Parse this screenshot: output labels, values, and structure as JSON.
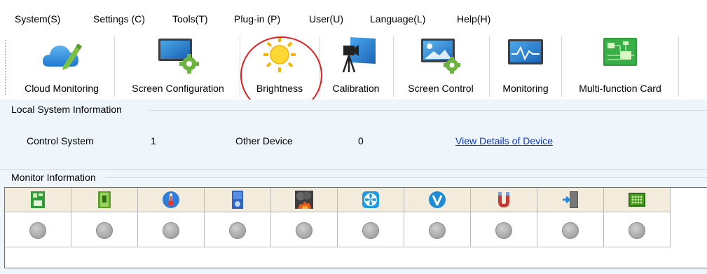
{
  "menu": {
    "items": [
      "System(S)",
      "Settings (C)",
      "Tools(T)",
      "Plug-in (P)",
      "User(U)",
      "Language(L)",
      "Help(H)"
    ]
  },
  "toolbar": {
    "tools": [
      {
        "label": "Cloud Monitoring",
        "icon": "cloud-edit-icon"
      },
      {
        "label": "Screen Configuration",
        "icon": "screen-gear-icon"
      },
      {
        "label": "Brightness",
        "icon": "sun-icon"
      },
      {
        "label": "Calibration",
        "icon": "camera-screen-icon"
      },
      {
        "label": "Screen Control",
        "icon": "screen-image-gear-icon"
      },
      {
        "label": "Monitoring",
        "icon": "monitor-wave-icon"
      },
      {
        "label": "Multi-function Card",
        "icon": "circuit-board-icon"
      }
    ],
    "highlighted": "Brightness",
    "highlight_color": "#e0201e"
  },
  "local_system": {
    "title": "Local System Information",
    "control_system_label": "Control System",
    "control_system_value": "1",
    "other_device_label": "Other Device",
    "other_device_value": "0",
    "details_link": "View Details of Device",
    "link_color": "#0b37d6"
  },
  "monitor": {
    "title": "Monitor Information",
    "columns": [
      "receiving-card-icon",
      "module-board-icon",
      "thermometer-icon",
      "cabinet-fan-board-icon",
      "smoke-fire-icon",
      "fan-icon",
      "voltage-icon",
      "magnet-cable-icon",
      "door-icon",
      "led-module-icon"
    ],
    "status_color": "#a9a9a9"
  },
  "colors": {
    "panel_bg": "#eef6fc",
    "header_bg": "#f3ecdc"
  }
}
